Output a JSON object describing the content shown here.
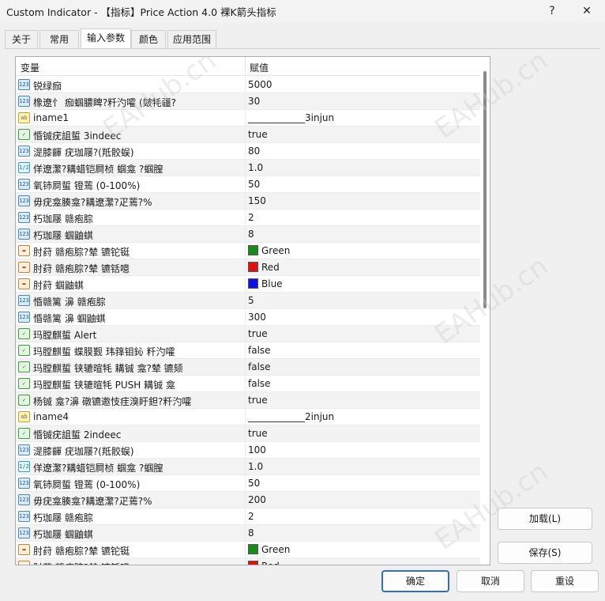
{
  "window": {
    "title": "Custom Indicator - 【指标】Price Action 4.0 裸K箭头指标",
    "help_label": "?",
    "close_label": "✕"
  },
  "tabs": [
    {
      "label": "关于",
      "active": false
    },
    {
      "label": "常用",
      "active": false
    },
    {
      "label": "输入参数",
      "active": true
    },
    {
      "label": "颜色",
      "active": false
    },
    {
      "label": "应用范围",
      "active": false
    }
  ],
  "table": {
    "col_variable": "变量",
    "col_value": "赋值",
    "rows": [
      {
        "type": "int",
        "icon_text": "123",
        "name": "锐绿痂",
        "value": "5000"
      },
      {
        "type": "int",
        "icon_text": "123",
        "name": "橡遼忄 痂蝈膿睥?粁汋嚯 (皴牦疆?",
        "value": "30"
      },
      {
        "type": "str",
        "icon_text": "ab",
        "name": "iname1",
        "value": "____________3injun"
      },
      {
        "type": "bool",
        "icon_text": "✓",
        "name": "惛铖疣詛蜇 3indeec",
        "value": "true"
      },
      {
        "type": "int",
        "icon_text": "123",
        "name": "湜膝齳 疣珈屦?(羝骹蜈)",
        "value": "80"
      },
      {
        "type": "dbl",
        "icon_text": "1/2",
        "name": "佯遼瀿?耩蜡铠屙桢 蝈龛 ?蝈膣",
        "value": "1.0"
      },
      {
        "type": "int",
        "icon_text": "123",
        "name": "氧铈屙蜇 镫蔫 (0-100%)",
        "value": "50"
      },
      {
        "type": "int",
        "icon_text": "123",
        "name": "毋疣龛腠龛?耩遼瀿?疋蔫?%",
        "value": "150"
      },
      {
        "type": "int",
        "icon_text": "123",
        "name": "朽珈屦 赣疱腙",
        "value": "2"
      },
      {
        "type": "int",
        "icon_text": "123",
        "name": "朽珈屦 蝈鼬蜞",
        "value": "8"
      },
      {
        "type": "col",
        "icon_text": "▬",
        "name": "肘荮 赣疱腙?辇 镳铊铤",
        "value": "Green",
        "swatch": "#1a8a1a"
      },
      {
        "type": "col",
        "icon_text": "▬",
        "name": "肘荮 赣疱腙?辇 镳铦噫",
        "value": "Red",
        "swatch": "#e01010"
      },
      {
        "type": "col",
        "icon_text": "▬",
        "name": "肘荮 蝈鼬蜞",
        "value": "Blue",
        "swatch": "#1010e0"
      },
      {
        "type": "int",
        "icon_text": "123",
        "name": "惛赣篱 濞 赣疱腙",
        "value": "5"
      },
      {
        "type": "int",
        "icon_text": "123",
        "name": "惛赣篱 濞 蝈鼬蜞",
        "value": "300"
      },
      {
        "type": "bool",
        "icon_text": "✓",
        "name": "玛膛麒蜇 Alert",
        "value": "true"
      },
      {
        "type": "bool",
        "icon_text": "✓",
        "name": "玛膛麒蜇 蝶膜觐 玮箨钼鈊 粁汋嚯",
        "value": "false"
      },
      {
        "type": "bool",
        "icon_text": "✓",
        "name": "玛膛麒蜇 铗辘暄牦 耩铖 龛?辇 镳颏",
        "value": "false"
      },
      {
        "type": "bool",
        "icon_text": "✓",
        "name": "玛膛麒蜇 铗辘暄牦 PUSH 耩铖 龛",
        "value": "false"
      },
      {
        "type": "bool",
        "icon_text": "✓",
        "name": "杨铖 龛?濞 礅镳邀忮疰溴盱鉭?粁汋嚯",
        "value": "true"
      },
      {
        "type": "str",
        "icon_text": "ab",
        "name": "iname4",
        "value": "____________2injun"
      },
      {
        "type": "bool",
        "icon_text": "✓",
        "name": "惛铖疣詛蜇 2indeec",
        "value": "true"
      },
      {
        "type": "int",
        "icon_text": "123",
        "name": "湜膝齳 疣珈屦?(羝骹蜈)",
        "value": "100"
      },
      {
        "type": "dbl",
        "icon_text": "1/2",
        "name": "佯遼瀿?耩蜡铠屙桢 蝈龛 ?蝈膣",
        "value": "1.0"
      },
      {
        "type": "int",
        "icon_text": "123",
        "name": "氧铈屙蜇 镫蔫 (0-100%)",
        "value": "50"
      },
      {
        "type": "int",
        "icon_text": "123",
        "name": "毋疣龛腠龛?耩遼瀿?疋蔫?%",
        "value": "200"
      },
      {
        "type": "int",
        "icon_text": "123",
        "name": "朽珈屦 赣疱腙",
        "value": "2"
      },
      {
        "type": "int",
        "icon_text": "123",
        "name": "朽珈屦 蝈鼬蜞",
        "value": "8"
      },
      {
        "type": "col",
        "icon_text": "▬",
        "name": "肘荮 赣疱腙?辇 镳铊铤",
        "value": "Green",
        "swatch": "#1a8a1a"
      },
      {
        "type": "col",
        "icon_text": "▬",
        "name": "肘荮 赣疱腙?辇 镳铦噫",
        "value": "Red",
        "swatch": "#e01010"
      }
    ]
  },
  "buttons": {
    "load": "加载(L)",
    "save": "保存(S)",
    "ok": "确定",
    "cancel": "取消",
    "reset": "重设"
  },
  "watermark": "EAHub.cn"
}
